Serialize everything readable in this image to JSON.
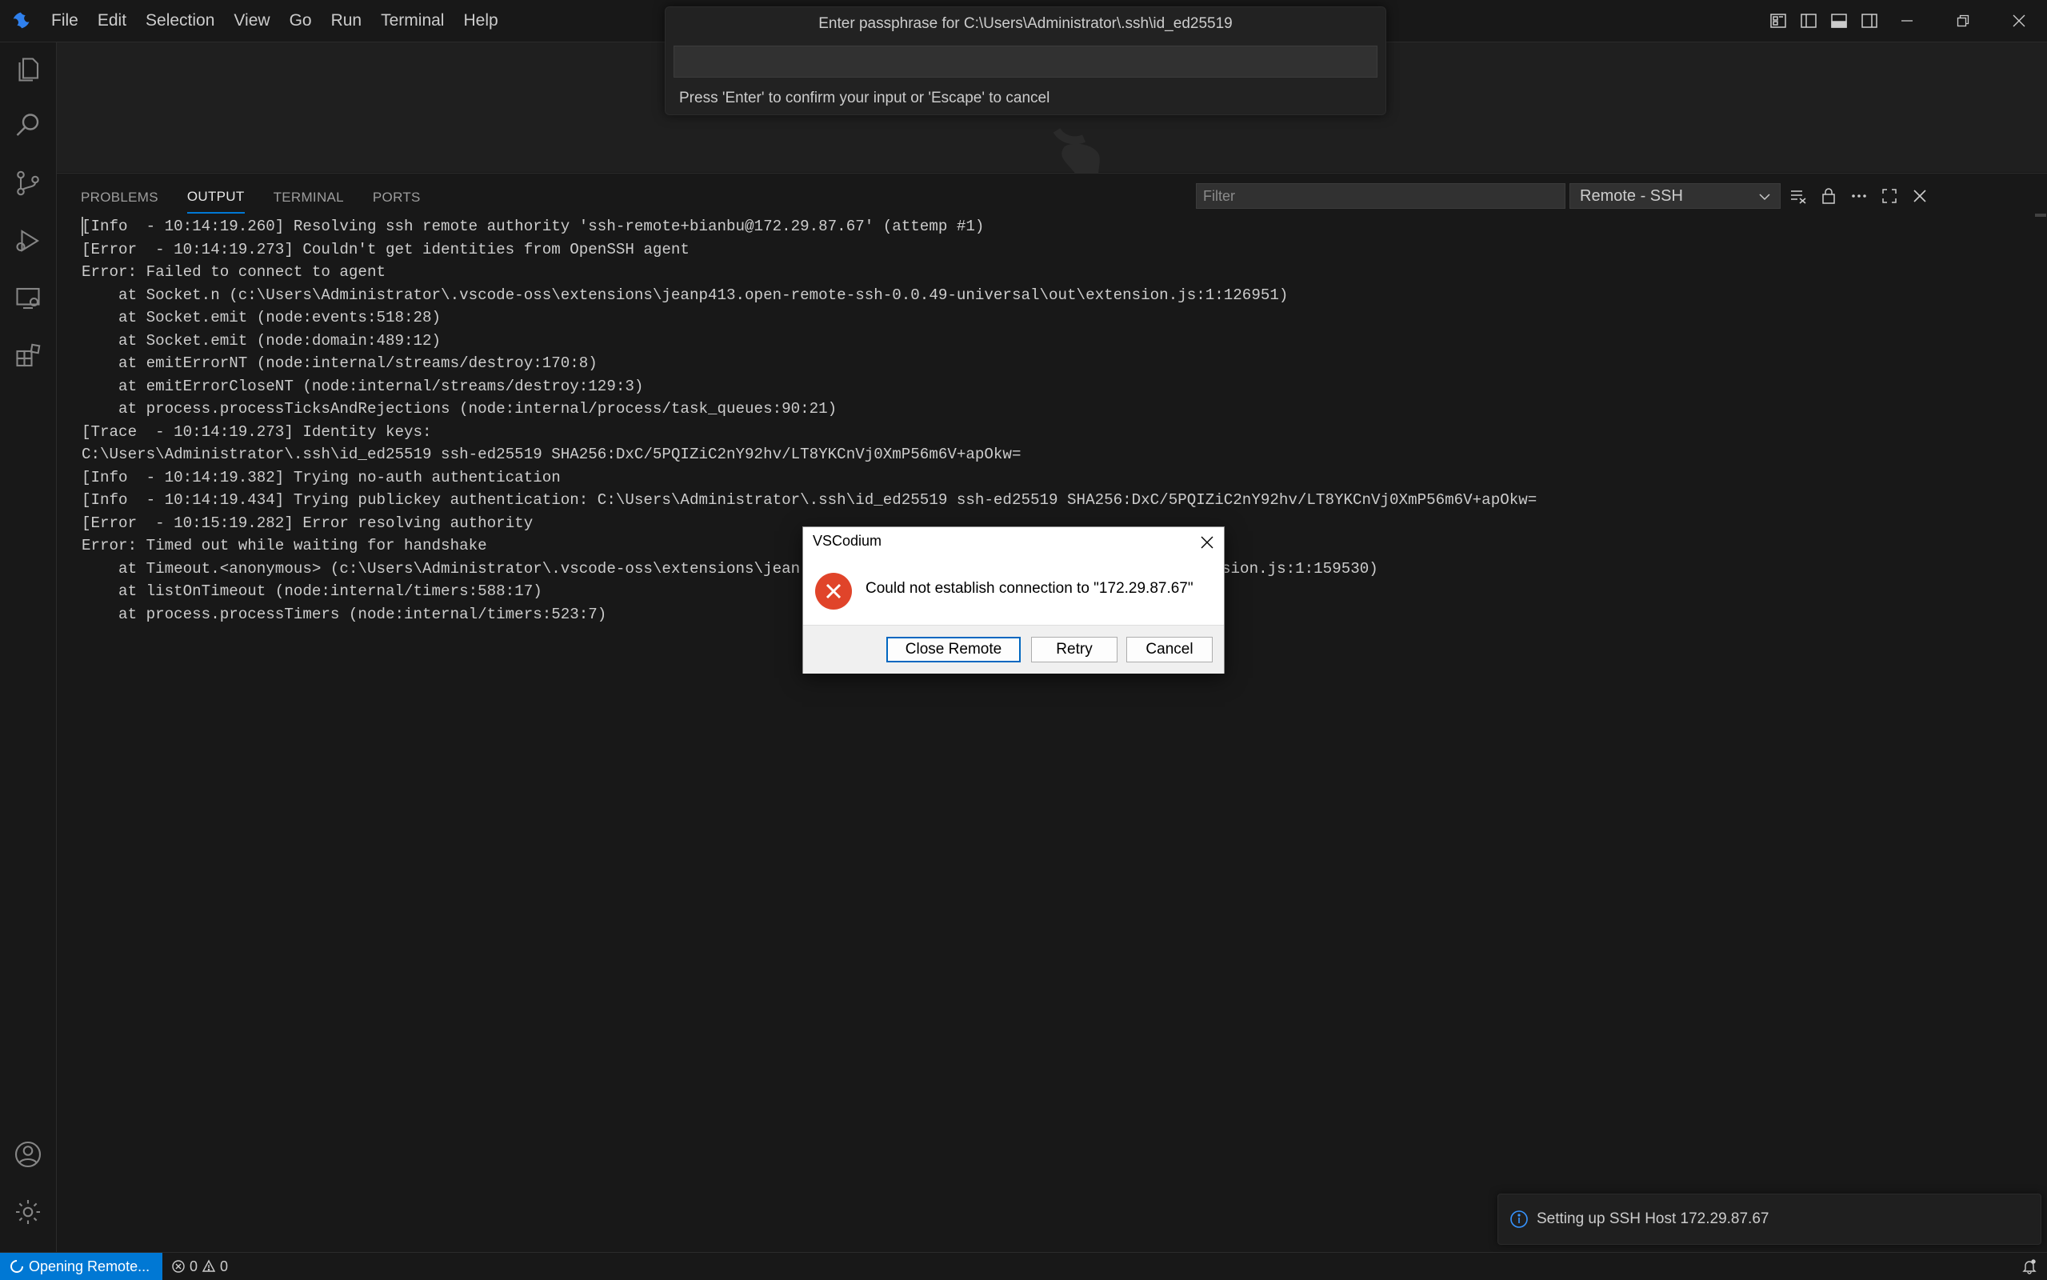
{
  "menu": [
    "File",
    "Edit",
    "Selection",
    "View",
    "Go",
    "Run",
    "Terminal",
    "Help"
  ],
  "panel": {
    "tabs": [
      "PROBLEMS",
      "OUTPUT",
      "TERMINAL",
      "PORTS"
    ],
    "active_tab": "OUTPUT",
    "filter_placeholder": "Filter",
    "channel": "Remote - SSH"
  },
  "output_lines": [
    "[Info  - 10:14:19.260] Resolving ssh remote authority 'ssh-remote+bianbu@172.29.87.67' (attemp #1)",
    "[Error  - 10:14:19.273] Couldn't get identities from OpenSSH agent",
    "Error: Failed to connect to agent",
    "    at Socket.n (c:\\Users\\Administrator\\.vscode-oss\\extensions\\jeanp413.open-remote-ssh-0.0.49-universal\\out\\extension.js:1:126951)",
    "    at Socket.emit (node:events:518:28)",
    "    at Socket.emit (node:domain:489:12)",
    "    at emitErrorNT (node:internal/streams/destroy:170:8)",
    "    at emitErrorCloseNT (node:internal/streams/destroy:129:3)",
    "    at process.processTicksAndRejections (node:internal/process/task_queues:90:21)",
    "[Trace  - 10:14:19.273] Identity keys:",
    "C:\\Users\\Administrator\\.ssh\\id_ed25519 ssh-ed25519 SHA256:DxC/5PQIZiC2nY92hv/LT8YKCnVj0XmP56m6V+apOkw=",
    "[Info  - 10:14:19.382] Trying no-auth authentication",
    "[Info  - 10:14:19.434] Trying publickey authentication: C:\\Users\\Administrator\\.ssh\\id_ed25519 ssh-ed25519 SHA256:DxC/5PQIZiC2nY92hv/LT8YKCnVj0XmP56m6V+apOkw=",
    "[Error  - 10:15:19.282] Error resolving authority",
    "Error: Timed out while waiting for handshake",
    "    at Timeout.<anonymous> (c:\\Users\\Administrator\\.vscode-oss\\extensions\\jean",
    "    at listOnTimeout (node:internal/timers:588:17)",
    "    at process.processTimers (node:internal/timers:523:7)"
  ],
  "output_partial_right": "ension.js:1:159530)",
  "quick_input": {
    "title": "Enter passphrase for C:\\Users\\Administrator\\.ssh\\id_ed25519",
    "value": "",
    "message": "Press 'Enter' to confirm your input or 'Escape' to cancel"
  },
  "dialog": {
    "title": "VSCodium",
    "message": "Could not establish connection to \"172.29.87.67\"",
    "buttons": {
      "close_remote": "Close Remote",
      "retry": "Retry",
      "cancel": "Cancel"
    }
  },
  "notification": {
    "text": "Setting up SSH Host 172.29.87.67"
  },
  "statusbar": {
    "remote": "Opening Remote...",
    "errors": "0",
    "warnings": "0"
  },
  "colors": {
    "accent": "#0078d4",
    "error": "#e0442a",
    "background": "#181818"
  }
}
